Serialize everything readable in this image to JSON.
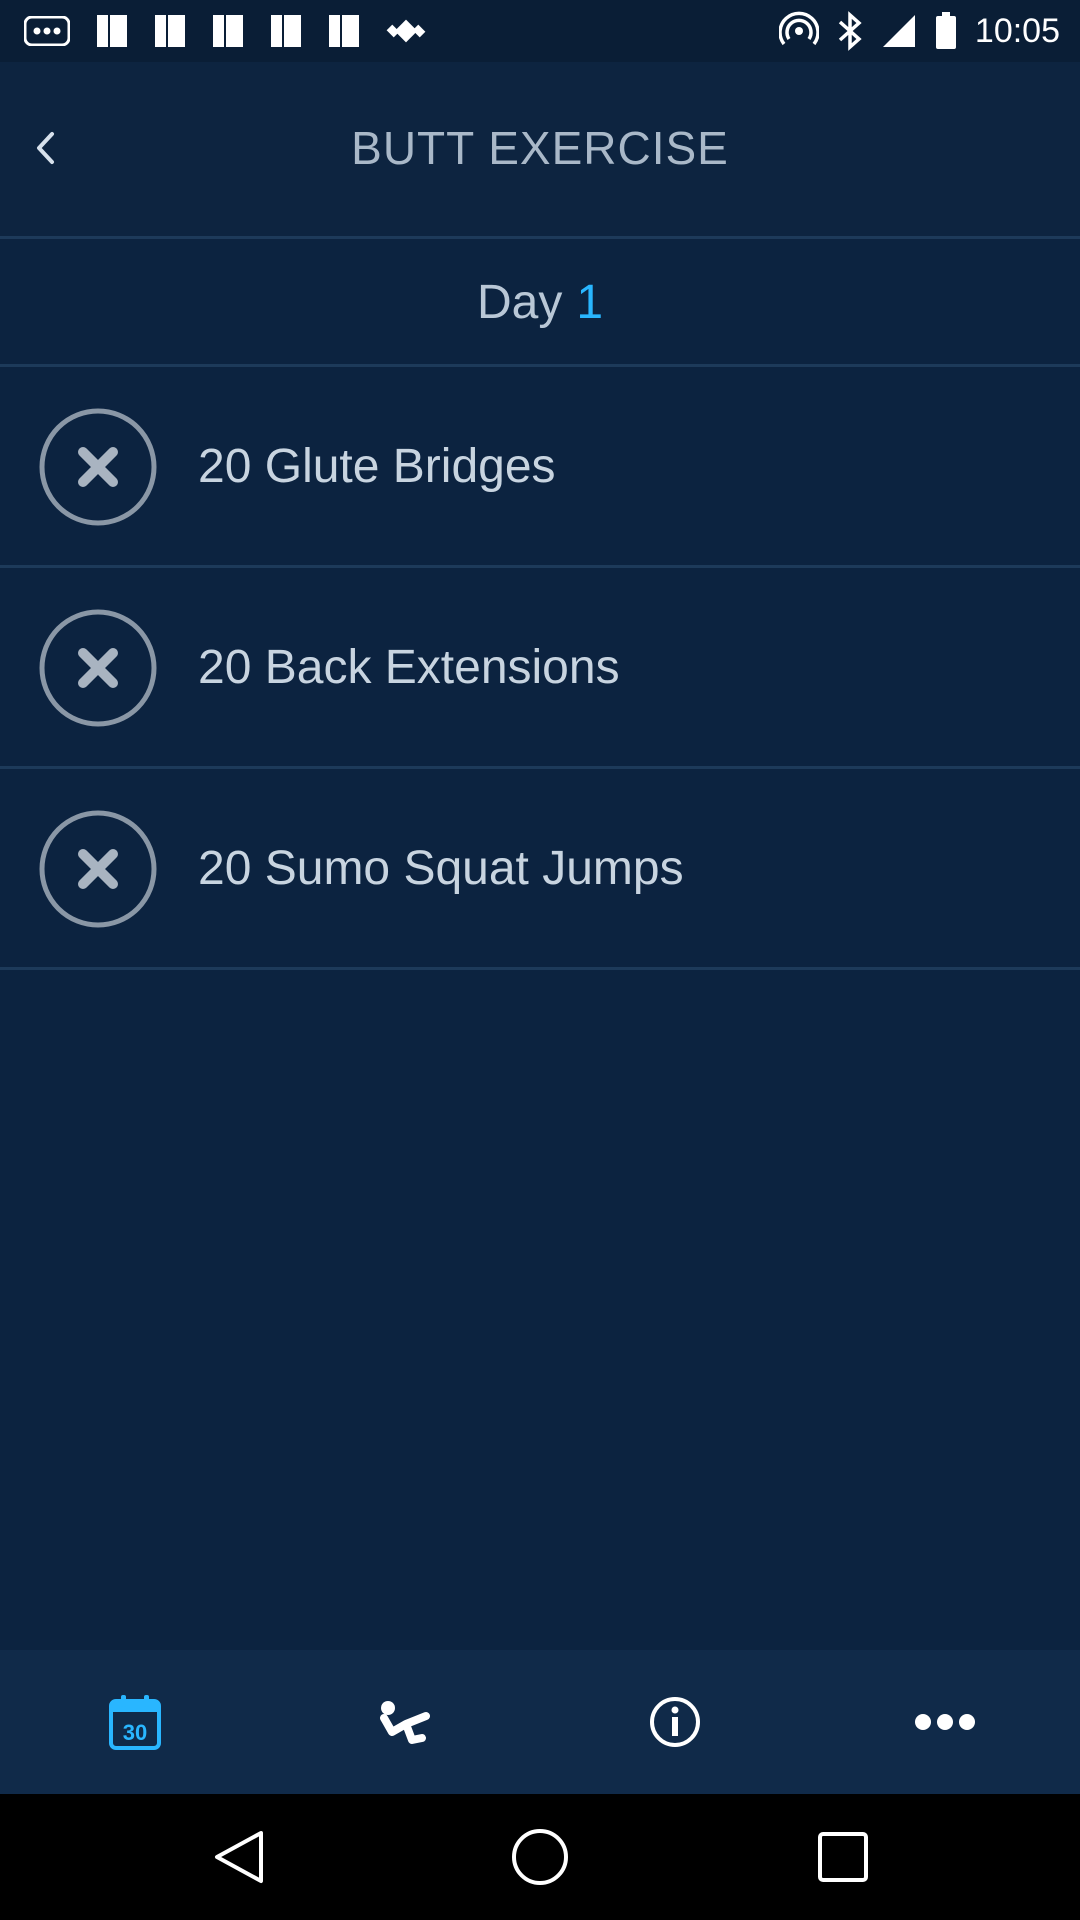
{
  "status_bar": {
    "time": "10:05",
    "icons": [
      "notification-dots-icon",
      "image-icon",
      "image-icon",
      "image-icon",
      "image-icon",
      "image-icon",
      "fake-gps-icon",
      "nfc-icon",
      "bluetooth-icon",
      "signal-icon",
      "battery-icon"
    ]
  },
  "header": {
    "title": "BUTT EXERCISE",
    "back_icon": "chevron-left-icon"
  },
  "day": {
    "label": "Day",
    "number": "1",
    "number_color": "#29b6ff"
  },
  "exercises": [
    {
      "label": "20 Glute Bridges",
      "status_icon": "close-circle-icon"
    },
    {
      "label": "20 Back Extensions",
      "status_icon": "close-circle-icon"
    },
    {
      "label": "20 Sumo Squat Jumps",
      "status_icon": "close-circle-icon"
    }
  ],
  "bottom_nav": {
    "items": [
      {
        "icon": "calendar-icon",
        "text": "30",
        "active": true
      },
      {
        "icon": "exercise-icon",
        "active": false
      },
      {
        "icon": "info-icon",
        "active": false
      },
      {
        "icon": "more-icon",
        "active": false
      }
    ],
    "active_color": "#29b6ff"
  },
  "system_nav": [
    "back-triangle-icon",
    "home-circle-icon",
    "recents-square-icon"
  ]
}
